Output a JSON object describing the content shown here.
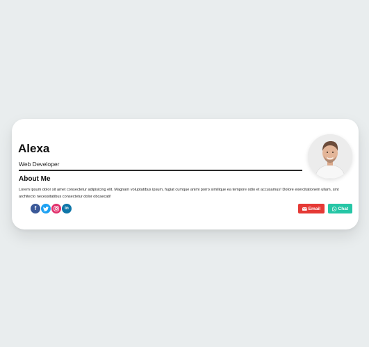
{
  "profile": {
    "name": "Alexa",
    "role": "Web Developer"
  },
  "about": {
    "heading": "About Me",
    "text": "Lorem ipsum dolor sit amet consectetur adipisicing elit. Magnam voluptatibus ipsum, fugiat cumque animi porro similique ea tempore odio et accusamus! Dolore exercitationem ullam, sint architecto necessitatibus consectetur dolor obcaecati!"
  },
  "socials": [
    {
      "name": "facebook",
      "icon": "facebook-icon",
      "glyph": "f",
      "color": "#3b5998"
    },
    {
      "name": "twitter",
      "icon": "twitter-icon",
      "glyph": "",
      "color": "#1da1f2"
    },
    {
      "name": "instagram",
      "icon": "instagram-icon",
      "glyph": "",
      "color": "#e1306c"
    },
    {
      "name": "linkedin",
      "icon": "linkedin-icon",
      "glyph": "in",
      "color": "#0e76a8"
    }
  ],
  "actions": {
    "email_label": "Email",
    "chat_label": "Chat",
    "email_color": "#e53935",
    "chat_color": "#26c6a6"
  }
}
